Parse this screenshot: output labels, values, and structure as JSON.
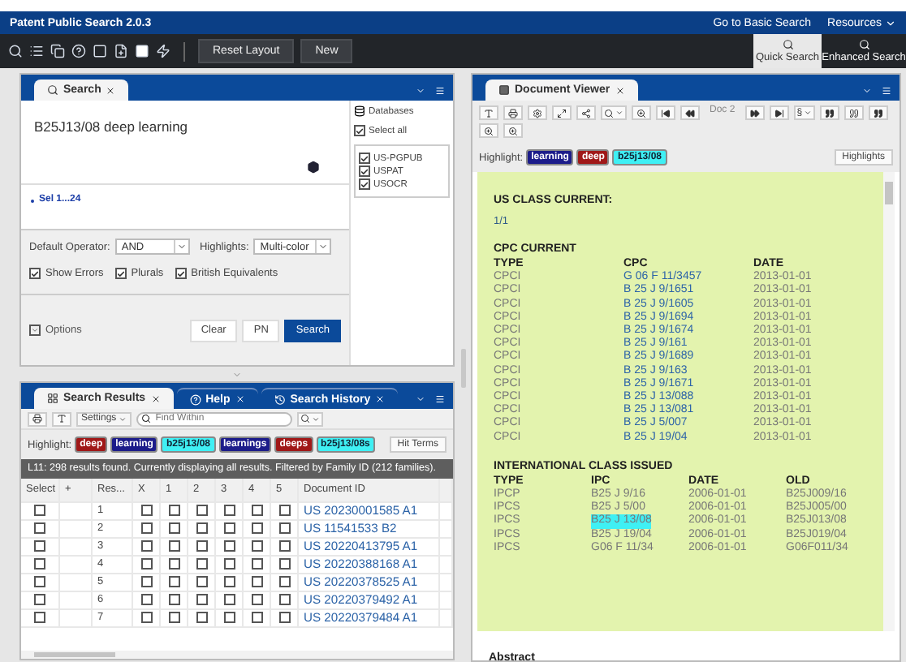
{
  "app_bar": {
    "title": "Patent Public Search 2.0.3",
    "links": [
      "Go to Basic Search",
      "Resources"
    ]
  },
  "toolbar": {
    "buttons": [
      "Reset Layout",
      "New"
    ],
    "modes": [
      {
        "label": "Quick Search",
        "selected": true
      },
      {
        "label": "Enhanced Search",
        "selected": false
      }
    ]
  },
  "search_panel": {
    "tab": "Search",
    "query": "B25J13/08 deep learning",
    "set_label": "Sel 1...24",
    "databases": {
      "label": "Databases",
      "select_all": {
        "label": "Select all",
        "checked": true
      },
      "items": [
        {
          "label": "US-PGPUB",
          "checked": true
        },
        {
          "label": "USPAT",
          "checked": true
        },
        {
          "label": "USOCR",
          "checked": true
        }
      ]
    },
    "operator": {
      "label": "Default Operator:",
      "value": "AND"
    },
    "highlights": {
      "label": "Highlights:",
      "value": "Multi-color"
    },
    "options": [
      {
        "label": "Show Errors",
        "checked": true
      },
      {
        "label": "Plurals",
        "checked": true
      },
      {
        "label": "British Equivalents",
        "checked": true
      }
    ],
    "options_label": "Options",
    "buttons": [
      "Clear",
      "PN",
      "Search"
    ]
  },
  "results_panel": {
    "tabs": [
      {
        "label": "Search Results",
        "selected": true
      },
      {
        "label": "Help",
        "selected": false
      },
      {
        "label": "Search History",
        "selected": false
      }
    ],
    "settings": "Settings",
    "find_placeholder": "Find Within",
    "highlight_label": "Highlight:",
    "terms": [
      {
        "text": "deep",
        "color": "#a01818"
      },
      {
        "text": "learning",
        "color": "#1c1c8a"
      },
      {
        "text": "b25j13/08",
        "color": "#3ff0f4"
      },
      {
        "text": "learnings",
        "color": "#1c1c8a"
      },
      {
        "text": "deeps",
        "color": "#a01818"
      },
      {
        "text": "b25j13/08s",
        "color": "#3ff0f4"
      }
    ],
    "hit_terms": "Hit Terms",
    "status": "L11: 298 results found. Currently displaying all results. Filtered by Family ID (212 families).",
    "columns": [
      "Select",
      "+",
      "Res...",
      "X",
      "1",
      "2",
      "3",
      "4",
      "5",
      "Document ID"
    ],
    "rows": [
      {
        "select": false,
        "result": "1",
        "x": false,
        "marks": [
          false,
          false,
          false,
          false,
          false
        ],
        "document_id": "US 20230001585 A1"
      },
      {
        "select": false,
        "result": "2",
        "x": false,
        "marks": [
          false,
          false,
          false,
          false,
          false
        ],
        "document_id": "US 11541533 B2"
      },
      {
        "select": false,
        "result": "3",
        "x": false,
        "marks": [
          false,
          false,
          false,
          false,
          false
        ],
        "document_id": "US 20220413795 A1"
      },
      {
        "select": false,
        "result": "4",
        "x": false,
        "marks": [
          false,
          false,
          false,
          false,
          false
        ],
        "document_id": "US 20220388168 A1"
      },
      {
        "select": false,
        "result": "5",
        "x": false,
        "marks": [
          false,
          false,
          false,
          false,
          false
        ],
        "document_id": "US 20220378525 A1"
      },
      {
        "select": false,
        "result": "6",
        "x": false,
        "marks": [
          false,
          false,
          false,
          false,
          false
        ],
        "document_id": "US 20220379492 A1"
      },
      {
        "select": false,
        "result": "7",
        "x": false,
        "marks": [
          false,
          false,
          false,
          false,
          false
        ],
        "document_id": "US 20220379484 A1"
      }
    ]
  },
  "document_viewer": {
    "tab": "Document Viewer",
    "doc": "Doc 2",
    "section_glyph": "§",
    "highlight_label": "Highlight:",
    "terms": [
      {
        "text": "learning",
        "color": "#1c1c8a"
      },
      {
        "text": "deep",
        "color": "#a01818"
      },
      {
        "text": "b25j13/08",
        "color": "#3ff0f4"
      }
    ],
    "highlights_button": "Highlights",
    "us_class": {
      "heading": "US CLASS CURRENT:",
      "value": "1/1"
    },
    "cpc": {
      "heading": "CPC CURRENT",
      "columns": [
        "TYPE",
        "CPC",
        "DATE"
      ],
      "rows": [
        [
          "CPCI",
          "G 06 F 11/3457",
          "2013-01-01"
        ],
        [
          "CPCI",
          "B 25 J 9/1651",
          "2013-01-01"
        ],
        [
          "CPCI",
          "B 25 J 9/1605",
          "2013-01-01"
        ],
        [
          "CPCI",
          "B 25 J 9/1694",
          "2013-01-01"
        ],
        [
          "CPCI",
          "B 25 J 9/1674",
          "2013-01-01"
        ],
        [
          "CPCI",
          "B 25 J 9/161",
          "2013-01-01"
        ],
        [
          "CPCI",
          "B 25 J 9/1689",
          "2013-01-01"
        ],
        [
          "CPCI",
          "B 25 J 9/163",
          "2013-01-01"
        ],
        [
          "CPCI",
          "B 25 J 9/1671",
          "2013-01-01"
        ],
        [
          "CPCI",
          "B 25 J 13/088",
          "2013-01-01"
        ],
        [
          "CPCI",
          "B 25 J 13/081",
          "2013-01-01"
        ],
        [
          "CPCI",
          "B 25 J 5/007",
          "2013-01-01"
        ],
        [
          "CPCI",
          "B 25 J 19/04",
          "2013-01-01"
        ]
      ]
    },
    "ipc": {
      "heading": "INTERNATIONAL CLASS ISSUED",
      "columns": [
        "TYPE",
        "IPC",
        "DATE",
        "OLD"
      ],
      "rows": [
        {
          "type": "IPCP",
          "ipc": "B25 J 9/16",
          "date": "2006-01-01",
          "old": "B25J009/16",
          "highlighted": false
        },
        {
          "type": "IPCS",
          "ipc": "B25 J 5/00",
          "date": "2006-01-01",
          "old": "B25J005/00",
          "highlighted": false
        },
        {
          "type": "IPCS",
          "ipc": "B25 J 13/08",
          "date": "2006-01-01",
          "old": "B25J013/08",
          "highlighted": true
        },
        {
          "type": "IPCS",
          "ipc": "B25 J 19/04",
          "date": "2006-01-01",
          "old": "B25J019/04",
          "highlighted": false
        },
        {
          "type": "IPCS",
          "ipc": "G06 F 11/34",
          "date": "2006-01-01",
          "old": "G06F011/34",
          "highlighted": false
        }
      ]
    },
    "abstract_heading": "Abstract"
  }
}
